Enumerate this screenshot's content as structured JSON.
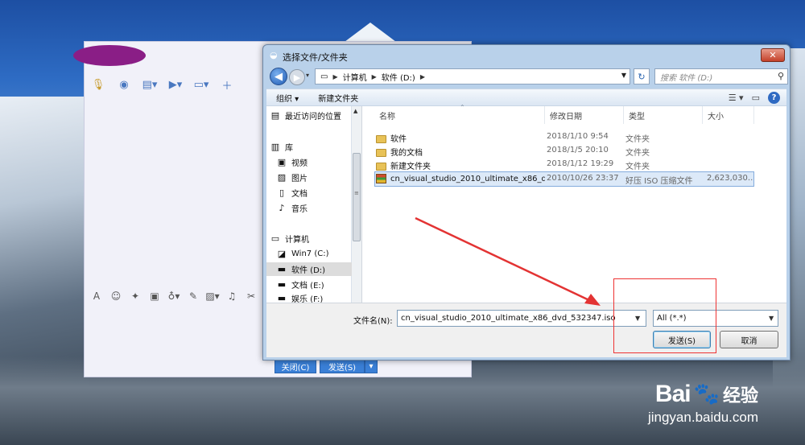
{
  "dialog": {
    "title": "选择文件/文件夹",
    "close_label": "✕",
    "address": [
      "计算机",
      "软件 (D:)"
    ],
    "search_placeholder": "搜索 软件 (D:)",
    "organize_label": "组织 ▾",
    "new_folder_label": "新建文件夹",
    "nav_items": [
      {
        "label": "最近访问的位置",
        "icon": "recent-icon"
      },
      {
        "label": "库",
        "icon": "library-icon"
      },
      {
        "label": "视频",
        "icon": "video-icon"
      },
      {
        "label": "图片",
        "icon": "picture-icon"
      },
      {
        "label": "文档",
        "icon": "document-icon"
      },
      {
        "label": "音乐",
        "icon": "music-icon"
      },
      {
        "label": "计算机",
        "icon": "computer-icon"
      },
      {
        "label": "Win7 (C:)",
        "icon": "drive-icon"
      },
      {
        "label": "软件 (D:)",
        "icon": "drive-icon",
        "selected": true
      },
      {
        "label": "文档 (E:)",
        "icon": "drive-icon"
      },
      {
        "label": "娱乐 (F:)",
        "icon": "drive-icon"
      }
    ],
    "columns": [
      "名称",
      "修改日期",
      "类型",
      "大小"
    ],
    "files": [
      {
        "name": "软件",
        "date": "2018/1/10 9:54",
        "type": "文件夹",
        "size": "",
        "icon": "folder"
      },
      {
        "name": "我的文档",
        "date": "2018/1/5 20:10",
        "type": "文件夹",
        "size": "",
        "icon": "folder"
      },
      {
        "name": "新建文件夹",
        "date": "2018/1/12 19:29",
        "type": "文件夹",
        "size": "",
        "icon": "folder"
      },
      {
        "name": "cn_visual_studio_2010_ultimate_x86_d...",
        "date": "2010/10/26 23:37",
        "type": "好压 ISO 压缩文件",
        "size": "2,623,030...",
        "icon": "iso",
        "selected": true
      }
    ],
    "filename_label": "文件名(N):",
    "filename_value": "cn_visual_studio_2010_ultimate_x86_dvd_532347.iso",
    "filetype_value": "All (*.*)",
    "send_button": "发送(S)",
    "cancel_button": "取消"
  },
  "chat": {
    "close_button": "关闭(C)",
    "send_button": "发送(S)"
  },
  "watermark": {
    "brand": "Bai",
    "brand2": "经验",
    "url": "jingyan.baidu.com"
  },
  "colors": {
    "annotation_red": "#e33333",
    "selection_blue": "#dce9f8"
  }
}
